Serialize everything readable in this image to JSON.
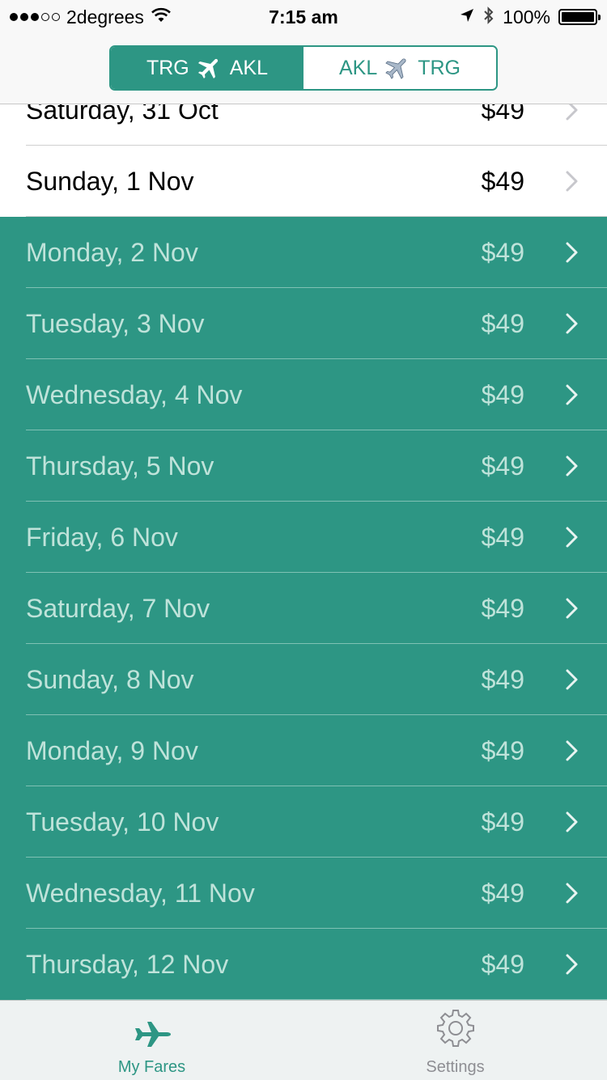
{
  "status_bar": {
    "carrier": "2degrees",
    "time": "7:15 am",
    "battery": "100%"
  },
  "segmented": {
    "left": {
      "from": "TRG",
      "to": "AKL"
    },
    "right": {
      "from": "AKL",
      "to": "TRG"
    }
  },
  "colors": {
    "accent": "#2d9684",
    "upcoming_text": "#bfe3da"
  },
  "fares": [
    {
      "date": "Saturday, 31 Oct",
      "price": "$49",
      "state": "past"
    },
    {
      "date": "Sunday, 1 Nov",
      "price": "$49",
      "state": "past"
    },
    {
      "date": "Monday, 2 Nov",
      "price": "$49",
      "state": "upcoming"
    },
    {
      "date": "Tuesday, 3 Nov",
      "price": "$49",
      "state": "upcoming"
    },
    {
      "date": "Wednesday, 4 Nov",
      "price": "$49",
      "state": "upcoming"
    },
    {
      "date": "Thursday, 5 Nov",
      "price": "$49",
      "state": "upcoming"
    },
    {
      "date": "Friday, 6 Nov",
      "price": "$49",
      "state": "upcoming"
    },
    {
      "date": "Saturday, 7 Nov",
      "price": "$49",
      "state": "upcoming"
    },
    {
      "date": "Sunday, 8 Nov",
      "price": "$49",
      "state": "upcoming"
    },
    {
      "date": "Monday, 9 Nov",
      "price": "$49",
      "state": "upcoming"
    },
    {
      "date": "Tuesday, 10 Nov",
      "price": "$49",
      "state": "upcoming"
    },
    {
      "date": "Wednesday, 11 Nov",
      "price": "$49",
      "state": "upcoming"
    },
    {
      "date": "Thursday, 12 Nov",
      "price": "$49",
      "state": "upcoming"
    }
  ],
  "tabbar": {
    "my_fares": {
      "label": "My Fares",
      "icon": "airplane-icon"
    },
    "settings": {
      "label": "Settings",
      "icon": "gear-icon"
    }
  }
}
